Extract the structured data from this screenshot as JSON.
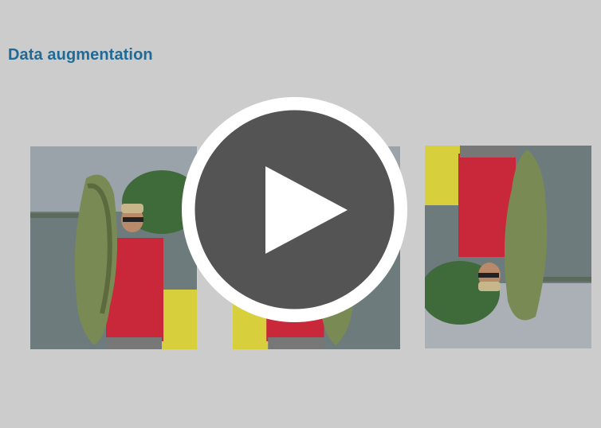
{
  "slide": {
    "title": "Data augmentation"
  },
  "images": [
    {
      "label": "original-photo",
      "transform": "none"
    },
    {
      "label": "flipped-photo",
      "transform": "horizontal-flip"
    },
    {
      "label": "rotated-photo",
      "transform": "rotate-180"
    }
  ],
  "overlay": {
    "icon": "play-icon",
    "color": "#545454",
    "ring_color": "#ffffff"
  },
  "colors": {
    "title": "#1f6a96",
    "background": "#cccccc"
  }
}
